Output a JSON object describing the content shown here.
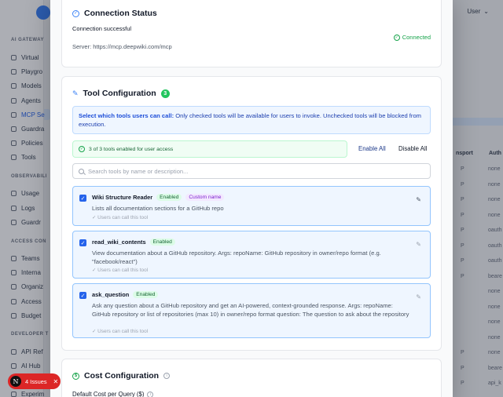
{
  "background": {
    "user_label": "User",
    "sections": [
      {
        "label": "AI GATEWAY"
      },
      {
        "label": "OBSERVABILI"
      },
      {
        "label": "ACCESS CON"
      },
      {
        "label": "DEVELOPER T"
      }
    ],
    "nav_items": [
      {
        "label": "Virtual"
      },
      {
        "label": "Playgro"
      },
      {
        "label": "Models"
      },
      {
        "label": "Agents"
      },
      {
        "label": "MCP Se"
      },
      {
        "label": "Guardra"
      },
      {
        "label": "Policies"
      },
      {
        "label": "Tools"
      },
      {
        "label": "Usage"
      },
      {
        "label": "Logs"
      },
      {
        "label": "Guardr"
      },
      {
        "label": "Teams"
      },
      {
        "label": "Interna"
      },
      {
        "label": "Organiz"
      },
      {
        "label": "Access"
      },
      {
        "label": "Budget"
      },
      {
        "label": "API Ref"
      },
      {
        "label": "AI Hub"
      },
      {
        "label": "Experim"
      }
    ],
    "table_headers": {
      "transport": "nsport",
      "auth": "Auth"
    },
    "table_rows": [
      {
        "transport": "P",
        "auth": "none"
      },
      {
        "transport": "P",
        "auth": "none"
      },
      {
        "transport": "P",
        "auth": "none"
      },
      {
        "transport": "P",
        "auth": "none"
      },
      {
        "transport": "P",
        "auth": "oauth"
      },
      {
        "transport": "P",
        "auth": "oauth"
      },
      {
        "transport": "P",
        "auth": "oauth"
      },
      {
        "transport": "P",
        "auth": "beare"
      },
      {
        "transport": "",
        "auth": "none"
      },
      {
        "transport": "",
        "auth": "none"
      },
      {
        "transport": "",
        "auth": "none"
      },
      {
        "transport": "",
        "auth": "none"
      },
      {
        "transport": "P",
        "auth": "none"
      },
      {
        "transport": "P",
        "auth": "beare"
      },
      {
        "transport": "P",
        "auth": "api_k"
      }
    ]
  },
  "connection": {
    "title": "Connection Status",
    "message": "Connection successful",
    "badge": "Connected",
    "server": "Server: https://mcp.deepwiki.com/mcp"
  },
  "tool_config": {
    "title": "Tool Configuration",
    "count": "3",
    "info_bold": "Select which tools users can call:",
    "info_text": " Only checked tools will be available for users to invoke. Unchecked tools will be blocked from execution.",
    "enabled_summary": "3 of 3 tools enabled for user access",
    "enable_all": "Enable All",
    "disable_all": "Disable All",
    "search_placeholder": "Search tools by name or description...",
    "tools": [
      {
        "name": "Wiki Structure Reader",
        "status": "Enabled",
        "custom": "Custom name",
        "description": "Lists all documentation sections for a GitHub repo",
        "note": "✓ Users can call this tool"
      },
      {
        "name": "read_wiki_contents",
        "status": "Enabled",
        "description": "View documentation about a GitHub repository. Args: repoName: GitHub repository in owner/repo format (e.g. \"facebook/react\")",
        "note": "✓ Users can call this tool"
      },
      {
        "name": "ask_question",
        "status": "Enabled",
        "description": "Ask any question about a GitHub repository and get an AI-powered, context-grounded response. Args: repoName: GitHub repository or list of repositories (max 10) in owner/repo format question: The question to ask about the repository",
        "note": "✓ Users can call this tool"
      }
    ]
  },
  "cost": {
    "title": "Cost Configuration",
    "field_label": "Default Cost per Query ($)"
  },
  "issues": {
    "label": "4 Issues",
    "logo_letter": "N"
  }
}
